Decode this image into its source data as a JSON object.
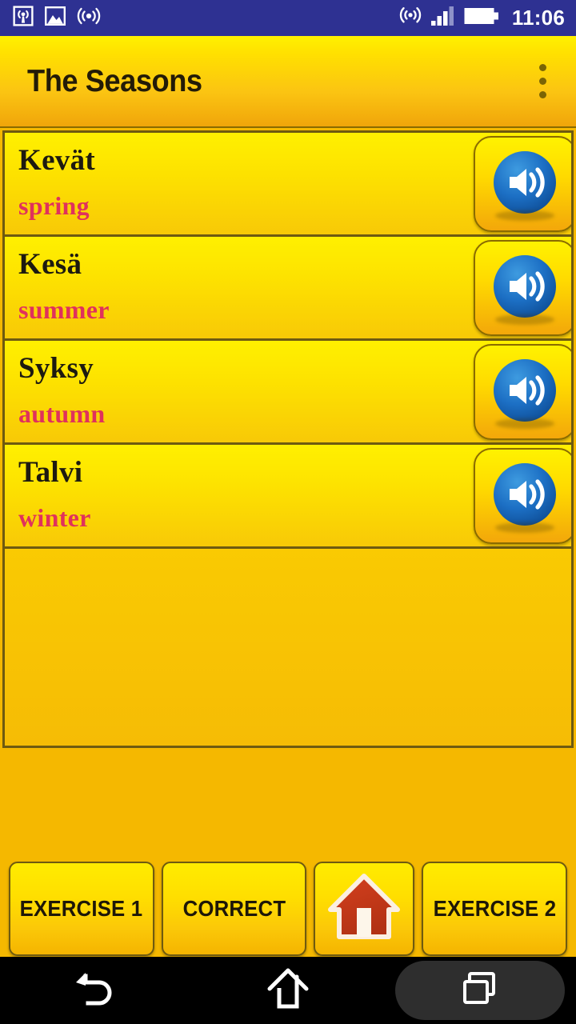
{
  "statusbar": {
    "time": "11:06",
    "left_icons": [
      "cast-icon",
      "image-icon",
      "hotspot-icon"
    ],
    "right_icons": [
      "nfc-icon",
      "signal-bars-icon",
      "battery-icon"
    ],
    "background_color": "#2E3192"
  },
  "appbar": {
    "title": "The Seasons",
    "overflow_label": "overflow-menu",
    "accent_top": "#FFF100",
    "accent_bottom": "#F0A50A"
  },
  "list": {
    "rows": [
      {
        "native": "Kevät",
        "translation": "spring",
        "speaker_icon": "speaker-icon"
      },
      {
        "native": "Kesä",
        "translation": "summer",
        "speaker_icon": "speaker-icon"
      },
      {
        "native": "Syksy",
        "translation": "autumn",
        "speaker_icon": "speaker-icon"
      },
      {
        "native": "Talvi",
        "translation": "winter",
        "speaker_icon": "speaker-icon"
      }
    ],
    "native_color": "#1D1A10",
    "translation_color": "#E0315C",
    "divider_color": "#6E5A10"
  },
  "buttons": {
    "exercise1": "EXERCISE 1",
    "correct": "CORRECT",
    "home_icon": "house-icon",
    "exercise2": "EXERCISE 2"
  },
  "navbar": {
    "back": "back-icon",
    "home": "home-icon",
    "recents": "recents-icon"
  }
}
